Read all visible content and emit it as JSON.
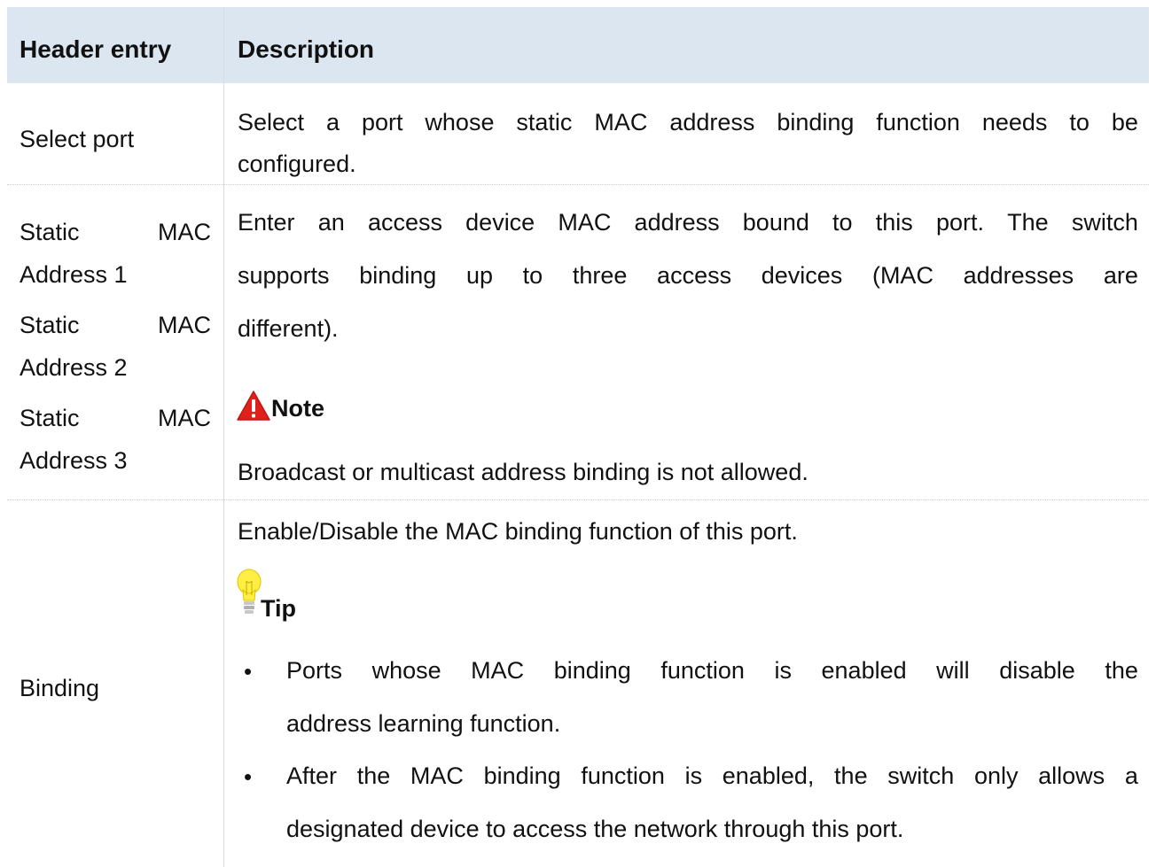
{
  "table": {
    "headers": {
      "entry": "Header entry",
      "description": "Description"
    },
    "rows": {
      "select_port": {
        "entry": "Select port",
        "description_line1_words": [
          "Select",
          "a",
          "port",
          "whose",
          "static",
          "MAC",
          "address",
          "binding",
          "function",
          "needs",
          "to",
          "be"
        ],
        "description_line2": "configured."
      },
      "static_mac": {
        "entry_1a_words": [
          "Static",
          "MAC"
        ],
        "entry_1b": "Address 1",
        "entry_2a_words": [
          "Static",
          "MAC"
        ],
        "entry_2b": "Address 2",
        "entry_3a_words": [
          "Static",
          "MAC"
        ],
        "entry_3b": "Address 3",
        "description_line1_words": [
          "Enter",
          "an",
          "access",
          "device",
          "MAC",
          "address",
          "bound",
          "to",
          "this",
          "port.",
          "The",
          "switch"
        ],
        "description_line2_words": [
          "supports",
          "binding",
          "up",
          "to",
          "three",
          "access",
          "devices",
          "(MAC",
          "addresses",
          "are"
        ],
        "description_line3": "different).",
        "note_title": "Note",
        "note_text": "Broadcast or multicast address binding is not allowed."
      },
      "binding": {
        "entry": "Binding",
        "description": "Enable/Disable the MAC binding function of this port.",
        "tip_title": "Tip",
        "bullet_symbol": "•",
        "tip1_line1_words": [
          "Ports",
          "whose",
          "MAC",
          "binding",
          "function",
          "is",
          "enabled",
          "will",
          "disable",
          "the"
        ],
        "tip1_line2": "address learning function.",
        "tip2_line1_words": [
          "After",
          "the",
          "MAC",
          "binding",
          "function",
          "is",
          "enabled,",
          "the",
          "switch",
          "only",
          "allows",
          "a"
        ],
        "tip2_line2": "designated device to access the network through this port."
      }
    }
  },
  "colors": {
    "header_bg": "#dce6f1",
    "note_icon": "#e0201b",
    "tip_icon": "#ffee44"
  },
  "icons": {
    "note": "warning-triangle-icon",
    "tip": "lightbulb-icon"
  }
}
